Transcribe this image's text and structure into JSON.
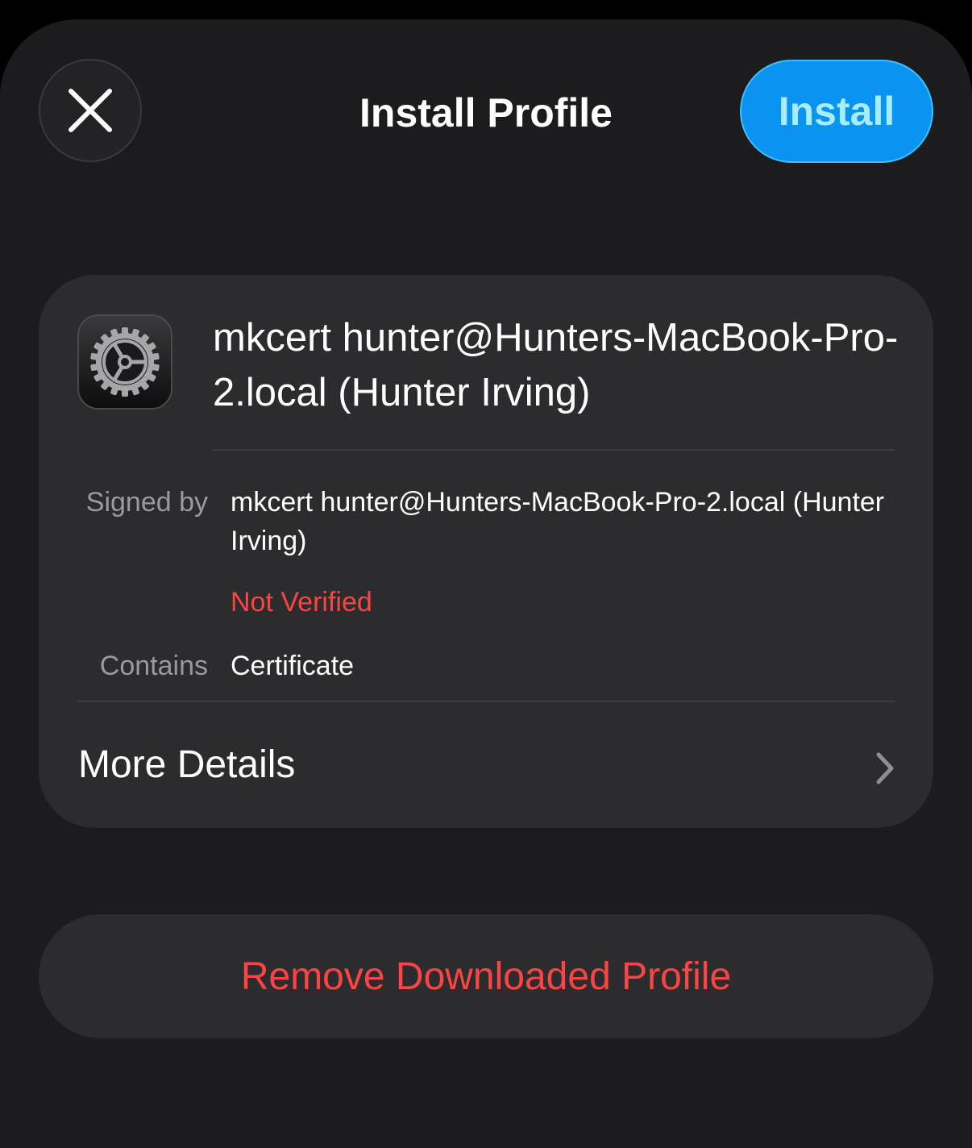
{
  "header": {
    "title": "Install Profile",
    "close_icon": "close-icon",
    "install_label": "Install"
  },
  "profile": {
    "icon": "settings-gear-icon",
    "name": "mkcert hunter@Hunters-MacBook-Pro-2.local (Hunter Irving)",
    "signed_by_label": "Signed by",
    "signed_by_value": "mkcert hunter@Hunters-MacBook-Pro-2.local (Hunter Irving)",
    "verification_status": "Not Verified",
    "contains_label": "Contains",
    "contains_value": "Certificate",
    "more_details_label": "More Details",
    "chevron_icon": "chevron-right-icon"
  },
  "footer": {
    "remove_label": "Remove Downloaded Profile"
  },
  "colors": {
    "background": "#1c1c1e",
    "card": "#2c2c2e",
    "accent_blue": "#0a93f0",
    "destructive_red": "#ff4444",
    "secondary_text": "#9a9a9e"
  }
}
